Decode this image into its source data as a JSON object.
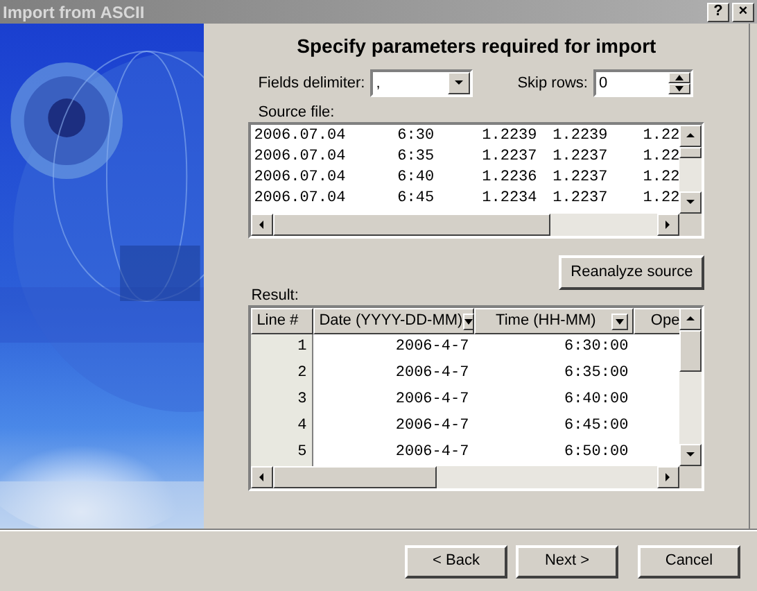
{
  "window": {
    "title": "Import from ASCII",
    "title_buttons": [
      "?",
      "×"
    ]
  },
  "heading": "Specify parameters required for import",
  "delimiter": {
    "label": "Fields delimiter:",
    "value": ","
  },
  "skip_rows": {
    "label": "Skip rows:",
    "value": "0"
  },
  "source_file": {
    "label": "Source file:",
    "lines": [
      [
        "2006.07.04",
        "6:30",
        "1.2239",
        "1.2239",
        "1.22"
      ],
      [
        "2006.07.04",
        "6:35",
        "1.2237",
        "1.2237",
        "1.22"
      ],
      [
        "2006.07.04",
        "6:40",
        "1.2236",
        "1.2237",
        "1.22"
      ],
      [
        "2006.07.04",
        "6:45",
        "1.2234",
        "1.2237",
        "1.22"
      ]
    ]
  },
  "reanalyze_button": "Reanalyze source",
  "result": {
    "label": "Result:",
    "columns": [
      {
        "label": "Line #",
        "dropdown": false
      },
      {
        "label": "Date (YYYY-DD-MM)",
        "dropdown": true
      },
      {
        "label": "Time (HH-MM)",
        "dropdown": true
      },
      {
        "label": "Ope",
        "dropdown": false
      }
    ],
    "rows": [
      [
        "1",
        "2006-4-7",
        "6:30:00"
      ],
      [
        "2",
        "2006-4-7",
        "6:35:00"
      ],
      [
        "3",
        "2006-4-7",
        "6:40:00"
      ],
      [
        "4",
        "2006-4-7",
        "6:45:00"
      ],
      [
        "5",
        "2006-4-7",
        "6:50:00"
      ]
    ]
  },
  "buttons": [
    "< Back",
    "Next >",
    "Cancel"
  ]
}
